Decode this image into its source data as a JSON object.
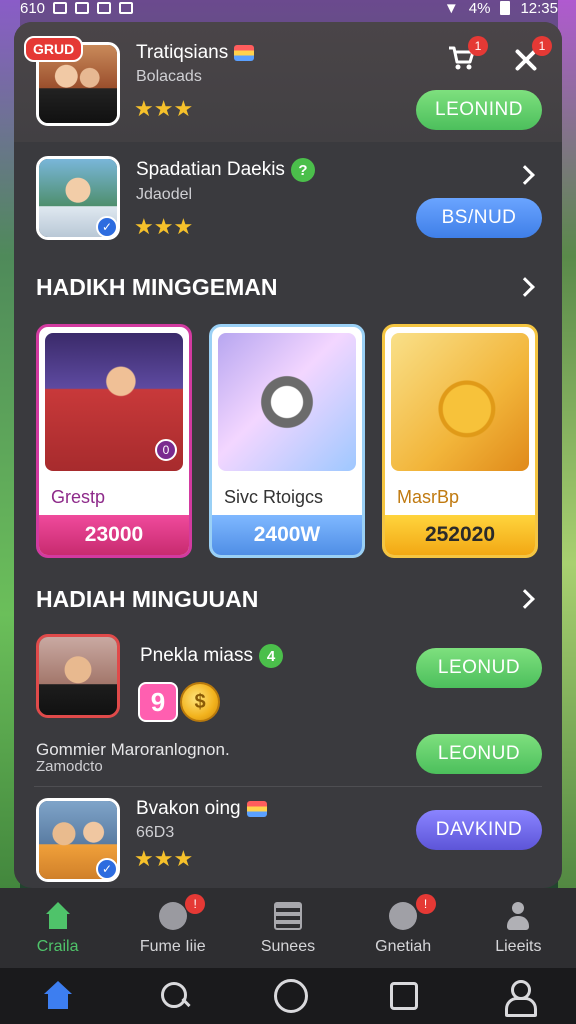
{
  "status_bar": {
    "left_text": "610",
    "battery_percent": "4%",
    "time": "12:35"
  },
  "featured": {
    "badge": "GRUD",
    "title": "Tratiqsians",
    "subtitle": "Bolacads",
    "stars": "★★★",
    "cart_badge": "1",
    "close_badge": "1",
    "button": "LEONIND"
  },
  "second_item": {
    "title": "Spadatian Daekis",
    "help_icon": "?",
    "subtitle": "Jdaodel",
    "stars": "★★★",
    "button": "BS/NUD"
  },
  "section1": {
    "title": "HADIKH MINGGEMAN",
    "cards": [
      {
        "name": "Grestp",
        "value": "23000",
        "art_badge": "0"
      },
      {
        "name": "Sivc Rtoigcs",
        "value": "2400W"
      },
      {
        "name": "MasrBp",
        "value": "252020"
      }
    ]
  },
  "section2": {
    "title": "HADIAH MINGUUAN",
    "items": [
      {
        "title": "Pnekla miass",
        "count": "4",
        "tile": "9",
        "coin": "$",
        "button": "LEONUD"
      },
      {
        "title": "Gommier Maroranlognon.",
        "subtitle": "Zamodcto",
        "button": "LEONUD"
      },
      {
        "title": "Bvakon oing",
        "subtitle": "66D3",
        "stars": "★★★",
        "button": "DAVKIND"
      }
    ]
  },
  "tabs": [
    {
      "label": "Craila",
      "icon": "home-icon",
      "active": true
    },
    {
      "label": "Fume Iiie",
      "icon": "face-icon",
      "badge": "!"
    },
    {
      "label": "Sunees",
      "icon": "list-icon"
    },
    {
      "label": "Gnetiah",
      "icon": "chat-icon",
      "badge": "!"
    },
    {
      "label": "Lieeits",
      "icon": "person-icon"
    }
  ],
  "colors": {
    "accent_green": "#4fc36a",
    "button_blue": "#3f7fe8",
    "button_purple": "#5d55d8",
    "badge_red": "#e53935",
    "star_gold": "#f6c12b"
  }
}
